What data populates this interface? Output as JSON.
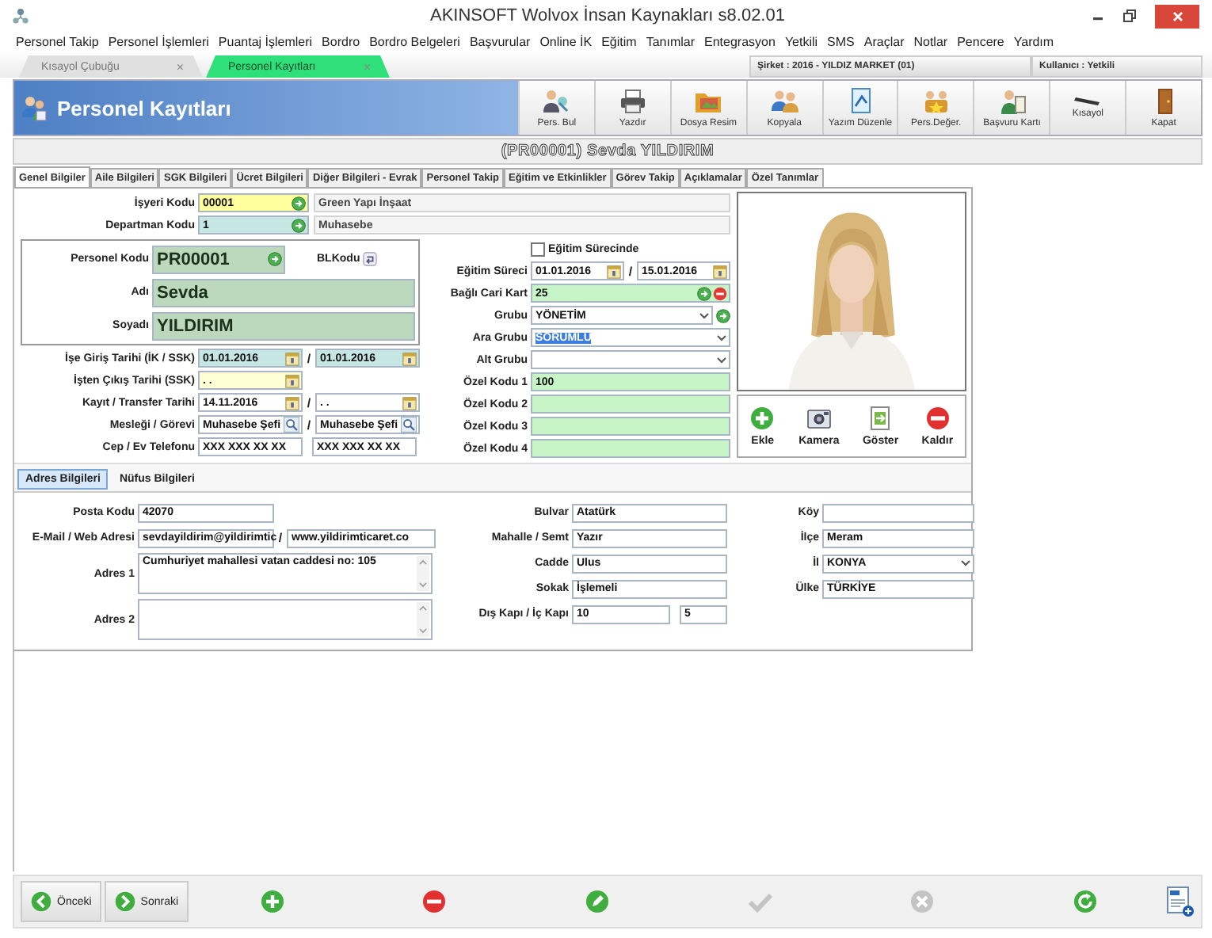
{
  "window": {
    "title": "AKINSOFT Wolvox İnsan Kaynakları s8.02.01"
  },
  "menu": [
    "Personel Takip",
    "Personel İşlemleri",
    "Puantaj İşlemleri",
    "Bordro",
    "Bordro Belgeleri",
    "Başvurular",
    "Online İK",
    "Eğitim",
    "Tanımlar",
    "Entegrasyon",
    "Yetkili",
    "SMS",
    "Araçlar",
    "Notlar",
    "Pencere",
    "Yardım"
  ],
  "doc_tabs": [
    {
      "label": "Kısayol Çubuğu",
      "close": "×",
      "selected": false
    },
    {
      "label": "Personel Kayıtları",
      "close": "×",
      "selected": true
    }
  ],
  "status": {
    "company": "Şirket : 2016 - YILDIZ MARKET (01)",
    "user": "Kullanıcı : Yetkili"
  },
  "header": {
    "title": "Personel Kayıtları"
  },
  "toolbar": [
    "Pers. Bul",
    "Yazdır",
    "Dosya Resim",
    "Kopyala",
    "Yazım Düzenle",
    "Pers.Değer.",
    "Başvuru Kartı",
    "Kısayol",
    "Kapat"
  ],
  "record_title": "(PR00001) Sevda YILDIRIM",
  "tabs": [
    {
      "label": "Genel Bilgiler",
      "selected": true
    },
    {
      "label": "Aile Bilgileri",
      "selected": false
    },
    {
      "label": "SGK Bilgileri",
      "selected": false
    },
    {
      "label": "Ücret Bilgileri",
      "selected": false
    },
    {
      "label": "Diğer Bilgileri - Evrak",
      "selected": false
    },
    {
      "label": "Personel Takip",
      "selected": false
    },
    {
      "label": "Eğitim ve Etkinlikler",
      "selected": false
    },
    {
      "label": "Görev Takip",
      "selected": false
    },
    {
      "label": "Açıklamalar",
      "selected": false
    },
    {
      "label": "Özel Tanımlar",
      "selected": false
    }
  ],
  "company_rows": [
    {
      "label": "İşyeri Kodu",
      "fields": [
        {
          "kind": "lookup",
          "color": "#ffff9e",
          "value": "00001"
        }
      ],
      "note": "Green Yapı İnşaat"
    },
    {
      "label": "Departman Kodu",
      "fields": [
        {
          "kind": "lookup",
          "color": "#c6e6e4",
          "value": "1"
        }
      ],
      "note": "Muhasebe"
    }
  ],
  "identity": {
    "code": {
      "label": "Personel Kodu",
      "fields": [
        {
          "kind": "large-lookup",
          "color": "#bcd9bd",
          "value": "PR00001"
        }
      ]
    },
    "bl_code_label": "BLKodu",
    "names": [
      {
        "label": "Adı",
        "fields": [
          {
            "kind": "large",
            "color": "#bcd9bd",
            "value": "Sevda"
          }
        ]
      },
      {
        "label": "Soyadı",
        "fields": [
          {
            "kind": "large",
            "color": "#bcd9bd",
            "value": "YILDIRIM"
          }
        ]
      }
    ]
  },
  "left_rows": [
    {
      "label": "İşe Giriş Tarihi (İK / SSK)",
      "separator": "/",
      "fields": [
        {
          "kind": "date",
          "color": "#c6e6e4",
          "value": "01.01.2016"
        },
        {
          "kind": "date",
          "color": "#c6e6e4",
          "value": "01.01.2016"
        }
      ]
    },
    {
      "label": "İşten Çıkış Tarihi (SSK)",
      "fields": [
        {
          "kind": "date",
          "color": "#ffffd6",
          "value": ". ."
        }
      ]
    },
    {
      "label": "Kayıt / Transfer Tarihi",
      "separator": "/",
      "fields": [
        {
          "kind": "date",
          "color": "#ffffff",
          "value": "14.11.2016"
        },
        {
          "kind": "date",
          "color": "#ffffff",
          "value": ". ."
        }
      ]
    },
    {
      "label": "Mesleği / Görevi",
      "separator": "/",
      "fields": [
        {
          "kind": "search",
          "color": "#ffffff",
          "value": "Muhasebe Şefi"
        },
        {
          "kind": "search",
          "color": "#ffffff",
          "value": "Muhasebe Şefi"
        }
      ]
    },
    {
      "label": "Cep / Ev Telefonu",
      "fields": [
        {
          "kind": "text",
          "color": "#ffffff",
          "value": "XXX XXX XX XX"
        },
        {
          "kind": "text",
          "color": "#ffffff",
          "value": "XXX XXX XX XX"
        }
      ]
    }
  ],
  "training_flag": {
    "label": "Eğitim Sürecinde",
    "checked": false
  },
  "mid_rows": [
    {
      "label": "Eğitim Süreci",
      "separator": "/",
      "fields": [
        {
          "kind": "date",
          "color": "#ffffff",
          "value": "01.01.2016"
        },
        {
          "kind": "date",
          "color": "#ffffff",
          "value": "15.01.2016"
        }
      ]
    },
    {
      "label": "Bağlı Cari Kart",
      "fields": [
        {
          "kind": "lookup-remove",
          "color": "#c8f5c8",
          "value": "25"
        }
      ]
    },
    {
      "label": "Grubu",
      "fields": [
        {
          "kind": "select-lookup",
          "color": "#ffffff",
          "value": "YÖNETİM",
          "text_selected": false
        }
      ]
    },
    {
      "label": "Ara Grubu",
      "fields": [
        {
          "kind": "select",
          "color": "#ffffff",
          "value": "SORUMLU",
          "text_selected": true
        }
      ]
    },
    {
      "label": "Alt Grubu",
      "fields": [
        {
          "kind": "select",
          "color": "#ffffff"
        }
      ]
    },
    {
      "label": "Özel Kodu 1",
      "fields": [
        {
          "kind": "text",
          "color": "#c8f5c8",
          "value": "100"
        }
      ]
    },
    {
      "label": "Özel Kodu 2",
      "fields": [
        {
          "kind": "text",
          "color": "#c8f5c8"
        }
      ]
    },
    {
      "label": "Özel Kodu 3",
      "fields": [
        {
          "kind": "text",
          "color": "#c8f5c8"
        }
      ]
    },
    {
      "label": "Özel Kodu 4",
      "fields": [
        {
          "kind": "text",
          "color": "#c8f5c8"
        }
      ]
    }
  ],
  "photo_actions": [
    "Ekle",
    "Kamera",
    "Göster",
    "Kaldır"
  ],
  "sub_tabs": [
    {
      "label": "Adres Bilgileri",
      "selected": true
    },
    {
      "label": "Nüfus Bilgileri",
      "selected": false
    }
  ],
  "address": [
    [
      {
        "label": "Posta Kodu",
        "fields": [
          {
            "kind": "text",
            "color": "#ffffff",
            "value": "42070"
          }
        ]
      },
      {
        "label": "E-Mail / Web Adresi",
        "separator": "/",
        "fields": [
          {
            "kind": "text",
            "color": "#ffffff",
            "value": "sevdayildirim@yildirimtic"
          },
          {
            "kind": "text",
            "color": "#ffffff",
            "value": "www.yildirimticaret.co"
          }
        ]
      },
      {
        "label": "Adres 1",
        "fields": [
          {
            "kind": "memo",
            "color": "#ffffff",
            "value": "Cumhuriyet mahallesi vatan caddesi no: 105"
          }
        ]
      },
      {
        "label": "Adres 2",
        "fields": [
          {
            "kind": "memo",
            "color": "#ffffff"
          }
        ]
      }
    ],
    [
      {
        "label": "Bulvar",
        "fields": [
          {
            "kind": "text",
            "color": "#ffffff",
            "value": "Atatürk"
          }
        ]
      },
      {
        "label": "Mahalle / Semt",
        "fields": [
          {
            "kind": "text",
            "color": "#ffffff",
            "value": "Yazır"
          }
        ]
      },
      {
        "label": "Cadde",
        "fields": [
          {
            "kind": "text",
            "color": "#ffffff",
            "value": "Ulus"
          }
        ]
      },
      {
        "label": "Sokak",
        "fields": [
          {
            "kind": "text",
            "color": "#ffffff",
            "value": "İşlemeli"
          }
        ]
      },
      {
        "label": "Dış Kapı / İç Kapı",
        "fields": [
          {
            "kind": "text",
            "color": "#ffffff",
            "value": "10"
          },
          {
            "kind": "text",
            "color": "#ffffff",
            "value": "5"
          }
        ]
      }
    ],
    [
      {
        "label": "Köy",
        "fields": [
          {
            "kind": "text",
            "color": "#ffffff"
          }
        ]
      },
      {
        "label": "İlçe",
        "fields": [
          {
            "kind": "text",
            "color": "#ffffff",
            "value": "Meram"
          }
        ]
      },
      {
        "label": "İl",
        "fields": [
          {
            "kind": "select",
            "color": "#ffffff",
            "value": "KONYA"
          }
        ]
      },
      {
        "label": "Ülke",
        "fields": [
          {
            "kind": "text",
            "color": "#ffffff",
            "value": "TÜRKİYE"
          }
        ]
      }
    ]
  ],
  "nav": [
    "Önceki",
    "Sonraki"
  ],
  "actions": [
    {
      "disabled": false
    },
    {
      "disabled": false
    },
    {
      "disabled": false
    },
    {
      "disabled": true
    },
    {
      "disabled": true
    },
    {
      "disabled": false
    }
  ]
}
